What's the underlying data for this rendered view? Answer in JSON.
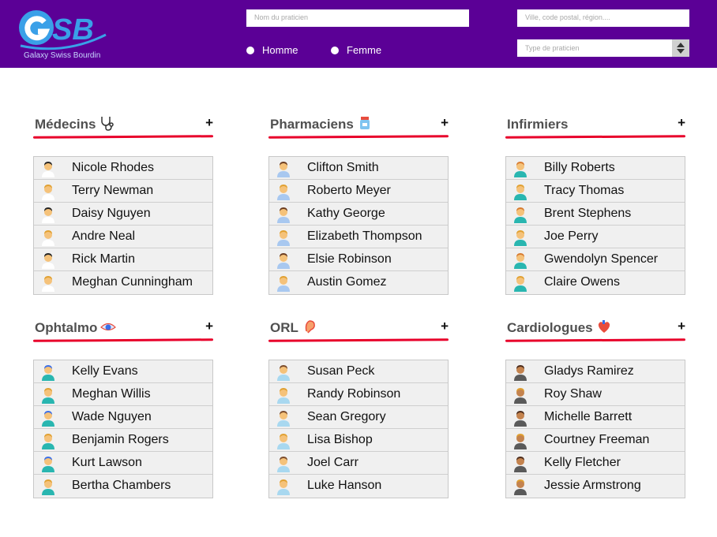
{
  "header": {
    "logo_text": "Galaxy Swiss Bourdin",
    "name_placeholder": "Nom du praticien",
    "location_placeholder": "Ville, code postal, région....",
    "type_placeholder": "Type de praticien",
    "gender_options": [
      "Homme",
      "Femme"
    ],
    "colors": {
      "header_bg": "#5b0096",
      "accent_underline": "#e8002a"
    }
  },
  "sections": [
    {
      "title": "Médecins",
      "icon": "stethoscope-icon",
      "add_label": "+",
      "items": [
        "Nicole Rhodes",
        "Terry Newman",
        "Daisy Nguyen",
        "Andre Neal",
        "Rick Martin",
        "Meghan Cunningham"
      ]
    },
    {
      "title": "Pharmaciens",
      "icon": "pill-bottle-icon",
      "add_label": "+",
      "items": [
        "Clifton Smith",
        "Roberto Meyer",
        "Kathy George",
        "Elizabeth Thompson",
        "Elsie Robinson",
        "Austin Gomez"
      ]
    },
    {
      "title": "Infirmiers",
      "icon": "",
      "add_label": "+",
      "items": [
        "Billy Roberts",
        "Tracy Thomas",
        "Brent Stephens",
        "Joe Perry",
        "Gwendolyn Spencer",
        "Claire Owens"
      ]
    },
    {
      "title": "Ophtalmo",
      "icon": "eye-icon",
      "add_label": "+",
      "items": [
        "Kelly Evans",
        "Meghan Willis",
        "Wade Nguyen",
        "Benjamin Rogers",
        "Kurt Lawson",
        "Bertha Chambers"
      ]
    },
    {
      "title": "ORL",
      "icon": "ear-icon",
      "add_label": "+",
      "items": [
        "Susan Peck",
        "Randy Robinson",
        "Sean Gregory",
        "Lisa Bishop",
        "Joel Carr",
        "Luke Hanson"
      ]
    },
    {
      "title": "Cardiologues",
      "icon": "heart-icon",
      "add_label": "+",
      "items": [
        "Gladys Ramirez",
        "Roy Shaw",
        "Michelle Barrett",
        "Courtney Freeman",
        "Kelly Fletcher",
        "Jessie Armstrong"
      ]
    }
  ]
}
